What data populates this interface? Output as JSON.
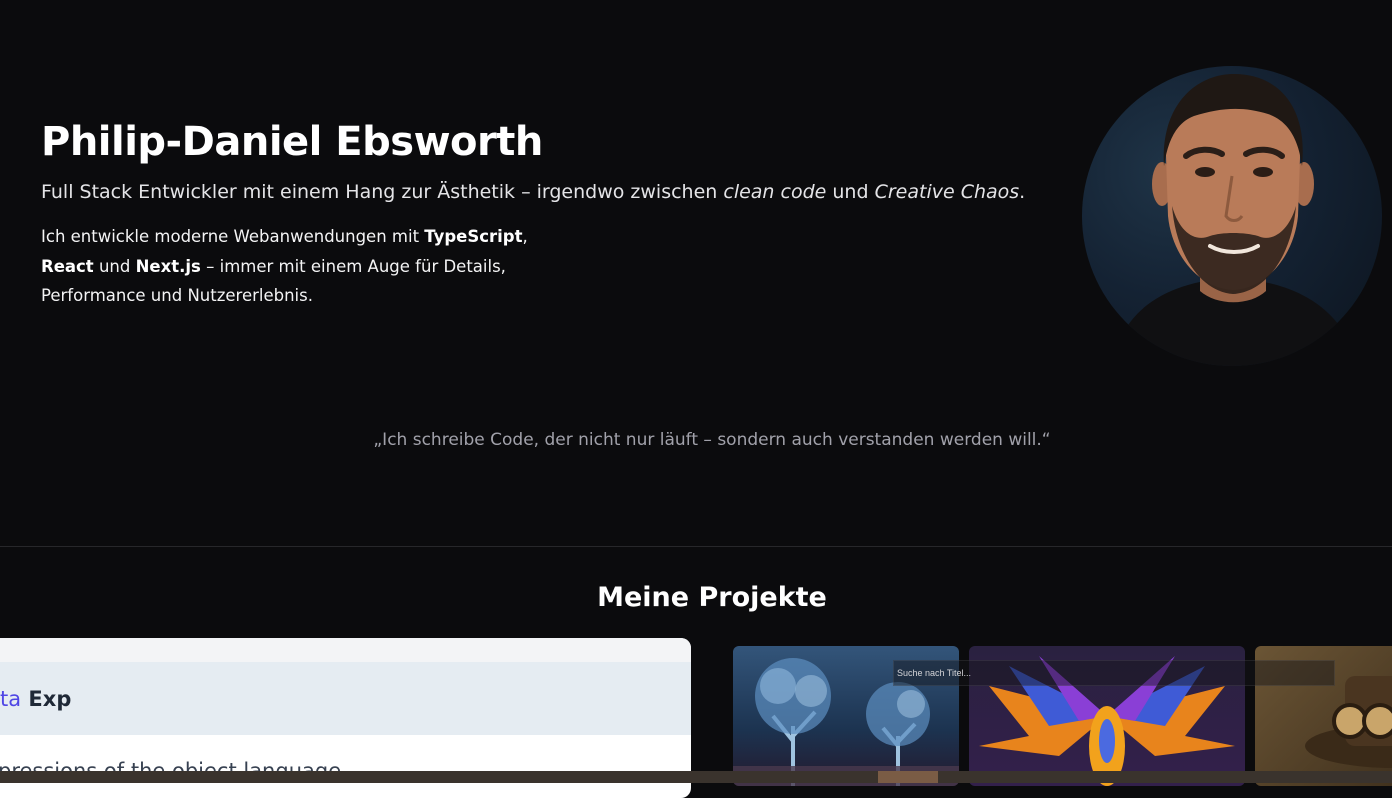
{
  "hero": {
    "name": "Philip-Daniel Ebsworth",
    "subtitle": {
      "part1": "Full Stack Entwickler mit einem Hang zur Ästhetik – irgendwo zwischen ",
      "em1": "clean code",
      "part2": " und ",
      "em2": "Creative Chaos",
      "part3": "."
    },
    "intro": {
      "t1": "Ich entwickle moderne Webanwendungen mit ",
      "b1": "TypeScript",
      "t2": ",",
      "b2": "React",
      "t3": " und ",
      "b3": "Next.js",
      "t4": " – immer mit einem Auge für Details,",
      "t5": "Performance und Nutzererlebnis."
    },
    "quote": "„Ich schreibe Code, der nicht nur läuft – sondern auch verstanden werden will.“"
  },
  "projects": {
    "title": "Meine Projekte",
    "card": {
      "keyword": "ta",
      "heading": "Exp",
      "body": "pressions of the object language"
    },
    "search_placeholder": "Suche nach Titel..."
  },
  "colors": {
    "background": "#0b0b0d",
    "accent_keyword": "#4f46e5",
    "muted_text": "#a1a1aa"
  }
}
